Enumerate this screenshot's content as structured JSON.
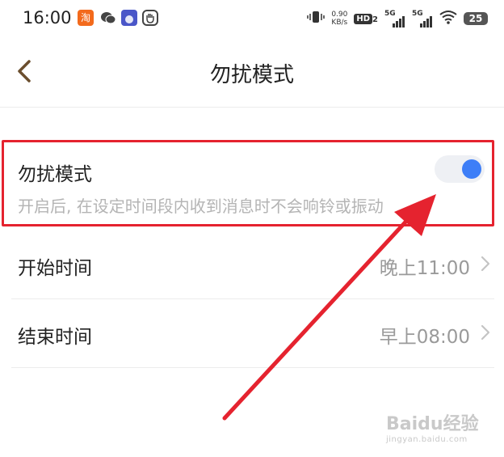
{
  "status_bar": {
    "time": "16:00",
    "icons": [
      "taobao-icon",
      "wechat-icon",
      "app-icon",
      "hand-icon"
    ],
    "net_speed_value": "0.90",
    "net_speed_unit": "KB/s",
    "hd_label": "HD",
    "hd_sub": "2",
    "signal1_label": "5G",
    "signal2_label": "5G",
    "battery_level": "25"
  },
  "header": {
    "title": "勿扰模式"
  },
  "dnd": {
    "label": "勿扰模式",
    "description": "开启后, 在设定时间段内收到消息时不会响铃或振动",
    "enabled": true
  },
  "schedule": {
    "start_label": "开始时间",
    "start_value": "晚上11:00",
    "end_label": "结束时间",
    "end_value": "早上08:00"
  },
  "watermark": {
    "logo": "Baidu经验",
    "url": "jingyan.baidu.com"
  },
  "colors": {
    "accent": "#3d7ef7",
    "annotation": "#e5232f",
    "back_arrow": "#6b4e2e"
  }
}
